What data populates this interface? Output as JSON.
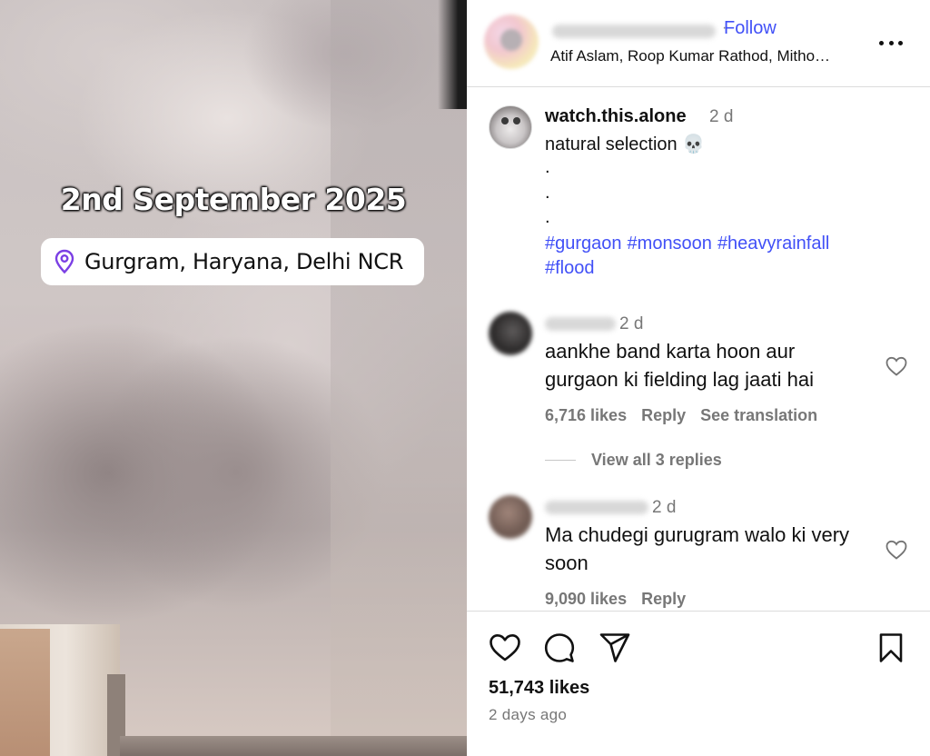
{
  "media": {
    "date_overlay": "2nd September 2025",
    "location_label": "Gurgram, Haryana, Delhi NCR",
    "location_icon": "location-pin-icon"
  },
  "header": {
    "follow_label": "Follow",
    "audio": "Atif Aslam, Roop Kumar Rathod, Mitho…",
    "more_icon": "more-options-icon"
  },
  "caption": {
    "username": "watch.this.alone",
    "time": "2 d",
    "text": "natural selection 💀",
    "dots": [
      ".",
      ".",
      "."
    ],
    "hashtags": [
      "#gurgaon",
      "#monsoon",
      "#heavyrainfall",
      "#flood"
    ]
  },
  "comments": [
    {
      "time": "2 d",
      "text": "aankhe band karta hoon aur gurgaon ki fielding lag jaati hai",
      "likes": "6,716 likes",
      "reply": "Reply",
      "translate": "See translation",
      "view_replies": "View all 3 replies"
    },
    {
      "time": "2 d",
      "text": "Ma chudegi gurugram walo ki very soon",
      "likes": "9,090 likes",
      "reply": "Reply"
    }
  ],
  "actions": {
    "likes": "51,743 likes",
    "posted": "2 days ago"
  },
  "colors": {
    "link_blue": "#4150f7",
    "muted_text": "#777777",
    "divider": "#dbdbdb"
  }
}
